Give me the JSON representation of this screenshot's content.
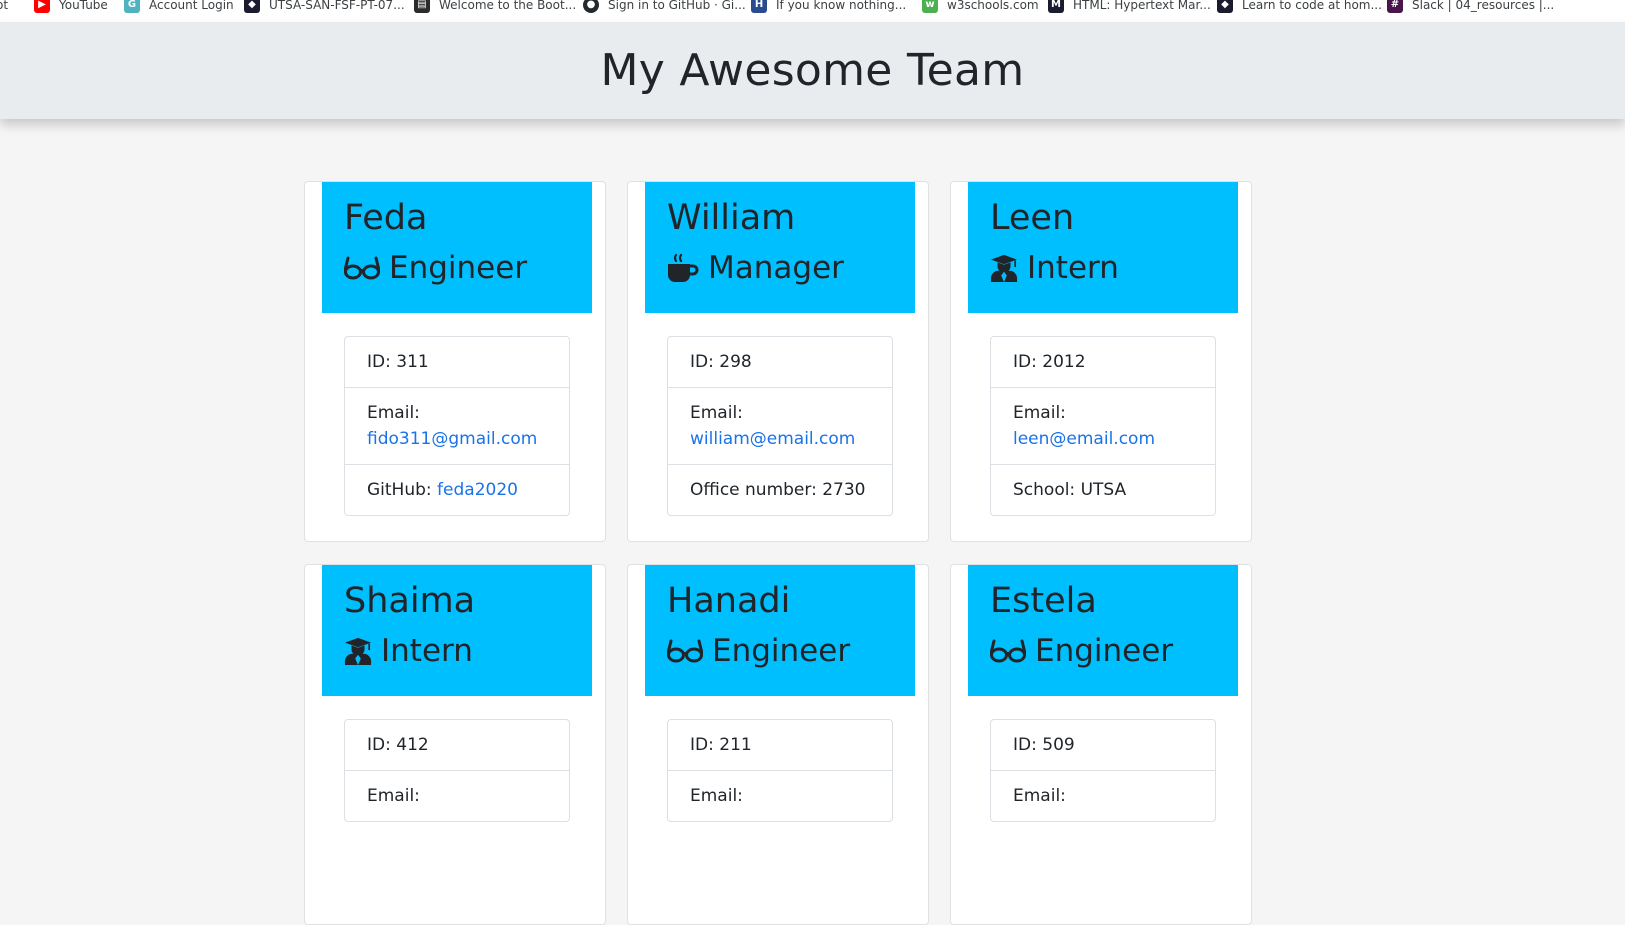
{
  "bookmarks": [
    {
      "label": "ot",
      "icon": "bookmark-icon",
      "color": "#888888"
    },
    {
      "label": "YouTube",
      "icon": "youtube-icon",
      "color": "#ff0000"
    },
    {
      "label": "Account Login",
      "icon": "account-icon",
      "color": "#4fb3bf"
    },
    {
      "label": "UTSA-SAN-FSF-PT-07...",
      "icon": "bootcamp-icon",
      "color": "#1b1b2f"
    },
    {
      "label": "Welcome to the Boot...",
      "icon": "document-icon",
      "color": "#2b2b2b"
    },
    {
      "label": "Sign in to GitHub · Gi...",
      "icon": "github-icon",
      "color": "#24292e"
    },
    {
      "label": "If you know nothing...",
      "icon": "hg-icon",
      "color": "#2a4b8d"
    },
    {
      "label": "w3schools.com",
      "icon": "w3schools-icon",
      "color": "#4caf50"
    },
    {
      "label": "HTML: Hypertext Mar...",
      "icon": "mdn-icon",
      "color": "#1b1b2f"
    },
    {
      "label": "Learn to code at hom...",
      "icon": "bootcamp-icon",
      "color": "#1b1b2f"
    },
    {
      "label": "Slack | 04_resources |...",
      "icon": "slack-icon",
      "color": "#4a154b"
    }
  ],
  "header": {
    "title": "My Awesome Team"
  },
  "colors": {
    "card_header": "#00bfff",
    "link": "#1a73e8",
    "header_bg": "#e9ecef"
  },
  "team": [
    {
      "name": "Feda",
      "role": "Engineer",
      "icon": "glasses-icon",
      "rows": [
        {
          "label": "ID: ",
          "value": "311"
        },
        {
          "label": "Email: ",
          "link": "fido311@gmail.com",
          "wrap": true
        },
        {
          "label": "GitHub: ",
          "link": "feda2020"
        }
      ]
    },
    {
      "name": "William",
      "role": "Manager",
      "icon": "mug-icon",
      "rows": [
        {
          "label": "ID: ",
          "value": "298"
        },
        {
          "label": "Email: ",
          "link": "william@email.com",
          "wrap": true
        },
        {
          "label": "Office number: ",
          "value": "2730"
        }
      ]
    },
    {
      "name": "Leen",
      "role": "Intern",
      "icon": "graduate-icon",
      "rows": [
        {
          "label": "ID: ",
          "value": "2012"
        },
        {
          "label": "Email: ",
          "link": "leen@email.com"
        },
        {
          "label": "School: ",
          "value": "UTSA"
        }
      ]
    },
    {
      "name": "Shaima",
      "role": "Intern",
      "icon": "graduate-icon",
      "rows": [
        {
          "label": "ID: ",
          "value": "412"
        },
        {
          "label": "Email: ",
          "link": ""
        }
      ]
    },
    {
      "name": "Hanadi",
      "role": "Engineer",
      "icon": "glasses-icon",
      "rows": [
        {
          "label": "ID: ",
          "value": "211"
        },
        {
          "label": "Email: ",
          "link": ""
        }
      ]
    },
    {
      "name": "Estela",
      "role": "Engineer",
      "icon": "glasses-icon",
      "rows": [
        {
          "label": "ID: ",
          "value": "509"
        },
        {
          "label": "Email: ",
          "link": ""
        }
      ]
    }
  ]
}
